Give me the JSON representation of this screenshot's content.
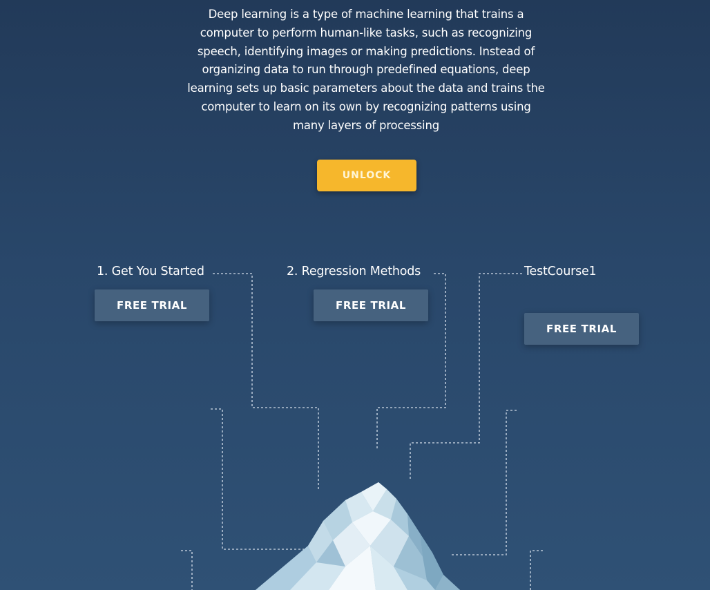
{
  "intro": {
    "lines": [
      "Deep learning is a type of machine learning that trains a",
      "computer to perform human-like tasks, such as recognizing",
      "speech, identifying images or making predictions. Instead of",
      "organizing data to run through predefined equations, deep",
      "learning sets up basic parameters about the data and trains the",
      "computer to learn on its own by recognizing patterns using",
      "many layers of processing"
    ]
  },
  "unlock": {
    "label": "UNLOCK"
  },
  "courses": [
    {
      "title": "1. Get You Started",
      "button": "FREE TRIAL"
    },
    {
      "title": "2. Regression Methods",
      "button": "FREE TRIAL"
    },
    {
      "title": "TestCourse1",
      "button": "FREE TRIAL"
    }
  ],
  "colors": {
    "background_top": "#223a59",
    "background_bottom": "#2f5175",
    "accent_button": "#f6b72c",
    "trial_button": "#46627f",
    "dashed_line": "#cfd9e6"
  },
  "icons": {
    "illustration": "iceberg-illustration"
  }
}
